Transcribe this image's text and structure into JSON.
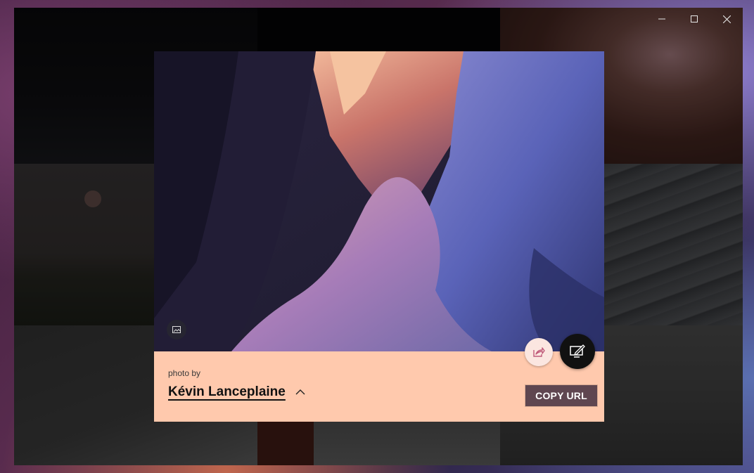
{
  "window": {
    "controls": {
      "minimize_icon": "minimize-icon",
      "maximize_icon": "maximize-icon",
      "close_icon": "close-icon"
    }
  },
  "dialog": {
    "photo_by_label": "photo by",
    "author_name": "Kévin Lanceplaine",
    "copy_url_label": "COPY URL",
    "panel_color": "#ffc9ad",
    "button_color": "#5f4650"
  }
}
